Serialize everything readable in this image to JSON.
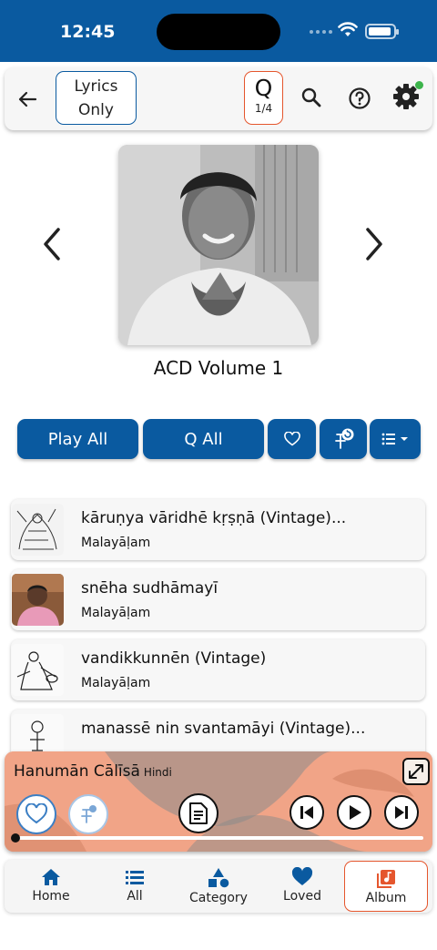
{
  "status_bar": {
    "time": "12:45"
  },
  "toolbar": {
    "lyrics_line1": "Lyrics",
    "lyrics_line2": "Only",
    "queue_letter": "Q",
    "queue_count": "1/4"
  },
  "album": {
    "title": "ACD Volume 1"
  },
  "actions": {
    "play_all": "Play All",
    "queue_all": "Q All"
  },
  "tracks": [
    {
      "title": "kāruṇya vāridhē kṛṣṇā (Vintage)...",
      "language": "Malayāḷam"
    },
    {
      "title": "snēha sudhāmayī",
      "language": "Malayāḷam"
    },
    {
      "title": "vandikkunnēn (Vintage)",
      "language": "Malayāḷam"
    },
    {
      "title": "manassē nin svantamāyi (Vintage)...",
      "language": ""
    }
  ],
  "now_playing": {
    "title": "Hanumān Cālīsā",
    "language": "Hindi",
    "progress": 0.0
  },
  "tabs": [
    {
      "label": "Home",
      "icon": "home-icon"
    },
    {
      "label": "All",
      "icon": "list-icon"
    },
    {
      "label": "Category",
      "icon": "shapes-icon"
    },
    {
      "label": "Loved",
      "icon": "heart-icon"
    },
    {
      "label": "Album",
      "icon": "album-icon",
      "active": true
    }
  ],
  "colors": {
    "primary": "#0a5aa0",
    "accent": "#e5562d",
    "player_bg": "#f1a487",
    "status_dot": "#3cb44b"
  }
}
